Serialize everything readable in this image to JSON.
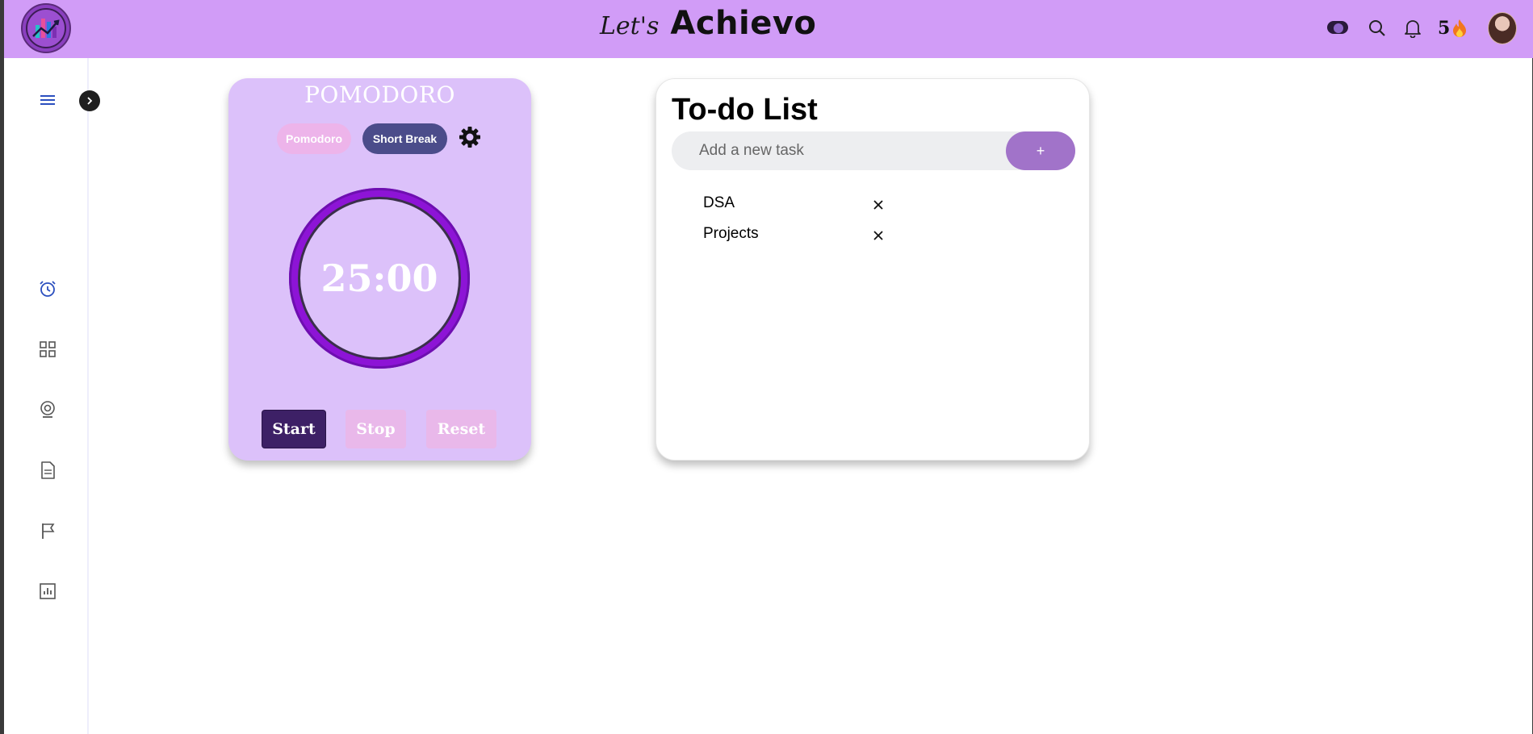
{
  "header": {
    "brand_prefix": "Let's",
    "brand_name": "Achievo",
    "streak_count": "5",
    "streak_icon": "fire-emoji",
    "icons": [
      "toggle-icon",
      "search-icon",
      "bell-icon"
    ],
    "background": "#d19cf7"
  },
  "sidebar": {
    "items": [
      {
        "icon": "menu-icon"
      },
      {
        "icon": "alarm-clock-icon"
      },
      {
        "icon": "grid-icon"
      },
      {
        "icon": "webcam-icon"
      },
      {
        "icon": "document-icon"
      },
      {
        "icon": "flag-icon"
      },
      {
        "icon": "bar-chart-icon"
      }
    ],
    "expand_icon": "chevron-right-icon"
  },
  "pomodoro": {
    "title": "POMODORO",
    "modes": [
      "Pomodoro",
      "Short Break"
    ],
    "active_mode": "Short Break",
    "timer": "25:00",
    "buttons": {
      "start": "Start",
      "stop": "Stop",
      "reset": "Reset"
    },
    "accent": "#8d14d6"
  },
  "todo": {
    "title": "To-do List",
    "input_placeholder": "Add a new task",
    "add_label": "+",
    "tasks": [
      {
        "label": "DSA"
      },
      {
        "label": "Projects"
      }
    ]
  }
}
